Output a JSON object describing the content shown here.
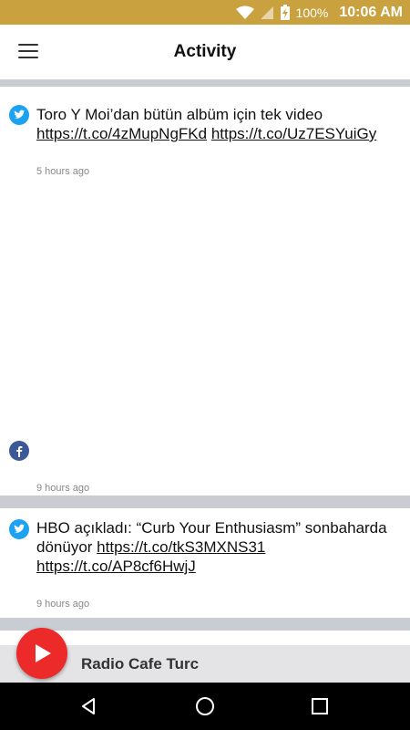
{
  "status_bar": {
    "battery_percent": "100%",
    "time": "10:06 AM",
    "icons": [
      "wifi-icon",
      "signal-icon",
      "battery-charging-icon"
    ]
  },
  "app_bar": {
    "title": "Activity",
    "menu_icon": "hamburger-menu-icon"
  },
  "feed": [
    {
      "source": "twitter",
      "text": "Toro Y Moi’dan bütün albüm için tek video ",
      "links": [
        "https://t.co/4zMupNgFKd",
        "https://t.co/Uz7ESYuiGy"
      ],
      "time": "5 hours ago"
    },
    {
      "source": "facebook",
      "text": "",
      "links": [],
      "time": "9 hours ago"
    },
    {
      "source": "twitter",
      "text": "HBO açıkladı: “Curb Your Enthusiasm” sonbaharda dönüyor ",
      "links": [
        "https://t.co/tkS3MXNS31",
        "https://t.co/AP8cf6HwjJ"
      ],
      "time": "9 hours ago"
    }
  ],
  "player": {
    "station_name": "Radio Cafe Turc",
    "play_icon": "play-icon"
  },
  "nav_bar": [
    "back-icon",
    "home-icon",
    "recents-icon"
  ],
  "colors": {
    "status_bar": "#c9a13f",
    "play_button": "#ec2a2a",
    "twitter": "#1da1f2",
    "facebook": "#3b5998"
  }
}
